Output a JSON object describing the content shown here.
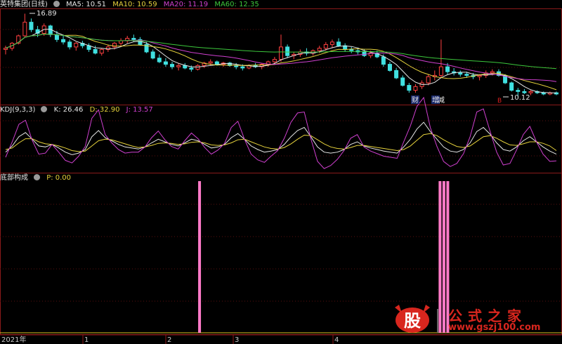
{
  "header": {
    "title": "英特集团(日线)",
    "ma": [
      {
        "label": "MA5: 10.51",
        "color": "#e6e6e6"
      },
      {
        "label": "MA10: 10.59",
        "color": "#e6d23c"
      },
      {
        "label": "MA20: 11.19",
        "color": "#d040d0"
      },
      {
        "label": "MA60: 12.35",
        "color": "#3cc83c"
      }
    ]
  },
  "kdj": {
    "title": "KDJ(9,3,3)",
    "k": "K: 26.46",
    "d": "D: 32.90",
    "j": "J: 13.57",
    "colors": {
      "k": "#e6e6e6",
      "d": "#e6d23c",
      "j": "#d040d0"
    }
  },
  "bottom": {
    "title": "底部构成",
    "p": "P: 0.00",
    "color": "#ff7ac8"
  },
  "annotations": {
    "high": "16.89",
    "low": "10.12",
    "badge_cai": "财",
    "badge_zeng": "增",
    "badge_jian": "减",
    "mark_red": "B"
  },
  "xaxis": {
    "labels": [
      "2021年",
      "1",
      "2",
      "3",
      "4"
    ]
  },
  "watermark": {
    "logo_text": "股",
    "title": "公式之家",
    "url": "www.gszj100.com"
  },
  "chart_data": [
    {
      "type": "candlestick",
      "title": "英特集团(日线)",
      "ylim": [
        9.6,
        17.2
      ],
      "high_label": 16.89,
      "low_label": 10.12,
      "ohlc": [
        [
          14.0,
          14.3,
          13.6,
          14.1
        ],
        [
          14.1,
          14.6,
          13.9,
          14.5
        ],
        [
          14.5,
          15.2,
          14.4,
          15.1
        ],
        [
          15.1,
          16.89,
          15.0,
          16.2
        ],
        [
          16.2,
          16.5,
          15.4,
          15.6
        ],
        [
          15.6,
          15.9,
          15.0,
          15.3
        ],
        [
          15.3,
          16.1,
          15.1,
          15.9
        ],
        [
          15.9,
          16.0,
          15.0,
          15.2
        ],
        [
          15.2,
          15.5,
          14.6,
          14.8
        ],
        [
          14.8,
          15.1,
          14.4,
          14.6
        ],
        [
          14.6,
          14.8,
          14.0,
          14.2
        ],
        [
          14.2,
          14.6,
          13.9,
          14.5
        ],
        [
          14.5,
          14.7,
          14.1,
          14.3
        ],
        [
          14.3,
          14.5,
          13.8,
          14.0
        ],
        [
          14.0,
          14.3,
          13.6,
          13.7
        ],
        [
          13.7,
          14.1,
          13.5,
          14.0
        ],
        [
          14.0,
          14.4,
          13.8,
          14.2
        ],
        [
          14.2,
          14.6,
          14.0,
          14.5
        ],
        [
          14.5,
          14.9,
          14.3,
          14.7
        ],
        [
          14.7,
          15.1,
          14.5,
          14.9
        ],
        [
          14.9,
          15.2,
          14.6,
          14.8
        ],
        [
          14.8,
          15.0,
          14.3,
          14.4
        ],
        [
          14.4,
          14.6,
          13.7,
          13.8
        ],
        [
          13.8,
          14.0,
          13.2,
          13.3
        ],
        [
          13.3,
          13.6,
          12.9,
          13.0
        ],
        [
          13.0,
          13.3,
          12.6,
          12.8
        ],
        [
          12.8,
          13.0,
          12.4,
          12.6
        ],
        [
          12.6,
          12.9,
          12.3,
          12.7
        ],
        [
          12.7,
          12.9,
          12.4,
          12.5
        ],
        [
          12.5,
          12.7,
          12.2,
          12.4
        ],
        [
          12.4,
          12.8,
          12.3,
          12.7
        ],
        [
          12.7,
          13.0,
          12.5,
          12.9
        ],
        [
          12.9,
          13.2,
          12.7,
          13.0
        ],
        [
          13.0,
          13.1,
          12.7,
          12.8
        ],
        [
          12.8,
          13.0,
          12.6,
          12.9
        ],
        [
          12.9,
          13.0,
          12.6,
          12.7
        ],
        [
          12.7,
          12.9,
          12.4,
          12.6
        ],
        [
          12.6,
          12.8,
          12.3,
          12.5
        ],
        [
          12.5,
          12.8,
          12.4,
          12.7
        ],
        [
          12.7,
          12.9,
          12.5,
          12.6
        ],
        [
          12.6,
          12.9,
          12.4,
          12.8
        ],
        [
          12.8,
          13.1,
          12.6,
          13.0
        ],
        [
          13.0,
          13.4,
          12.8,
          13.2
        ],
        [
          13.2,
          15.2,
          13.0,
          14.2
        ],
        [
          14.2,
          14.4,
          13.3,
          13.5
        ],
        [
          13.5,
          13.8,
          13.2,
          13.6
        ],
        [
          13.6,
          14.0,
          13.4,
          13.8
        ],
        [
          13.8,
          14.1,
          13.5,
          13.7
        ],
        [
          13.7,
          14.0,
          13.5,
          13.9
        ],
        [
          13.9,
          14.3,
          13.7,
          14.1
        ],
        [
          14.1,
          14.6,
          13.9,
          14.4
        ],
        [
          14.4,
          14.8,
          14.1,
          14.6
        ],
        [
          14.6,
          14.9,
          14.2,
          14.3
        ],
        [
          14.3,
          14.5,
          13.8,
          14.0
        ],
        [
          14.0,
          14.2,
          13.7,
          13.9
        ],
        [
          13.9,
          14.1,
          13.6,
          13.8
        ],
        [
          13.8,
          14.0,
          13.4,
          13.5
        ],
        [
          13.5,
          13.9,
          13.3,
          13.7
        ],
        [
          13.7,
          13.9,
          13.3,
          13.4
        ],
        [
          13.4,
          13.6,
          12.6,
          12.8
        ],
        [
          12.8,
          13.0,
          12.2,
          12.3
        ],
        [
          12.3,
          12.5,
          11.6,
          11.7
        ],
        [
          11.7,
          11.9,
          11.0,
          11.1
        ],
        [
          11.1,
          11.3,
          10.5,
          10.7
        ],
        [
          10.7,
          11.2,
          10.5,
          11.0
        ],
        [
          11.0,
          11.5,
          10.8,
          11.3
        ],
        [
          11.3,
          12.0,
          11.1,
          11.8
        ],
        [
          11.8,
          12.3,
          11.5,
          11.9
        ],
        [
          11.9,
          14.8,
          11.7,
          12.6
        ],
        [
          12.6,
          12.9,
          12.0,
          12.2
        ],
        [
          12.2,
          12.5,
          11.9,
          12.1
        ],
        [
          12.1,
          12.3,
          11.8,
          12.0
        ],
        [
          12.0,
          12.2,
          11.7,
          11.9
        ],
        [
          11.9,
          12.1,
          11.6,
          11.8
        ],
        [
          11.8,
          12.0,
          11.5,
          11.9
        ],
        [
          11.9,
          12.3,
          11.7,
          12.1
        ],
        [
          12.1,
          12.4,
          11.9,
          12.2
        ],
        [
          12.2,
          12.4,
          11.8,
          11.9
        ],
        [
          11.9,
          12.0,
          11.2,
          11.3
        ],
        [
          11.3,
          11.4,
          10.6,
          10.7
        ],
        [
          10.7,
          10.9,
          10.12,
          10.6
        ],
        [
          10.6,
          10.8,
          10.4,
          10.5
        ],
        [
          10.5,
          10.7,
          10.3,
          10.6
        ],
        [
          10.6,
          10.7,
          10.4,
          10.5
        ],
        [
          10.5,
          10.6,
          10.3,
          10.4
        ],
        [
          10.4,
          10.6,
          10.3,
          10.5
        ],
        [
          10.5,
          10.6,
          10.3,
          10.4
        ]
      ]
    },
    {
      "type": "line",
      "title": "KDJ(9,3,3)",
      "ylim": [
        -10,
        110
      ],
      "series": [
        {
          "name": "K",
          "values": [
            30,
            42,
            60,
            68,
            55,
            42,
            40,
            45,
            38,
            30,
            25,
            28,
            35,
            60,
            72,
            58,
            52,
            45,
            40,
            38,
            36,
            40,
            48,
            55,
            50,
            45,
            42,
            48,
            55,
            52,
            45,
            38,
            40,
            45,
            58,
            66,
            55,
            42,
            35,
            30,
            32,
            35,
            45,
            60,
            72,
            78,
            60,
            40,
            30,
            28,
            30,
            35,
            45,
            50,
            42,
            38,
            35,
            32,
            30,
            28,
            40,
            55,
            75,
            88,
            70,
            55,
            40,
            32,
            30,
            35,
            48,
            70,
            78,
            65,
            48,
            35,
            32,
            40,
            52,
            60,
            50,
            40,
            32,
            26
          ]
        },
        {
          "name": "D",
          "values": [
            35,
            38,
            48,
            56,
            56,
            50,
            46,
            45,
            42,
            38,
            33,
            31,
            32,
            42,
            52,
            55,
            54,
            50,
            46,
            42,
            39,
            40,
            43,
            47,
            48,
            47,
            45,
            46,
            49,
            50,
            48,
            44,
            43,
            44,
            48,
            54,
            55,
            50,
            45,
            40,
            37,
            36,
            39,
            46,
            55,
            63,
            62,
            54,
            46,
            40,
            37,
            36,
            39,
            43,
            43,
            41,
            39,
            37,
            35,
            33,
            35,
            42,
            53,
            64,
            66,
            62,
            54,
            47,
            41,
            39,
            42,
            51,
            60,
            62,
            57,
            50,
            44,
            43,
            46,
            50,
            50,
            47,
            42,
            33
          ]
        },
        {
          "name": "J",
          "values": [
            20,
            50,
            84,
            92,
            53,
            26,
            28,
            45,
            30,
            14,
            9,
            22,
            41,
            96,
            112,
            64,
            48,
            35,
            28,
            30,
            30,
            40,
            58,
            71,
            54,
            41,
            36,
            52,
            67,
            56,
            39,
            26,
            34,
            47,
            78,
            90,
            55,
            26,
            15,
            10,
            22,
            33,
            57,
            88,
            106,
            108,
            56,
            12,
            -2,
            4,
            16,
            33,
            57,
            64,
            40,
            32,
            27,
            22,
            20,
            18,
            50,
            81,
            119,
            136,
            78,
            41,
            12,
            2,
            8,
            27,
            60,
            108,
            114,
            71,
            30,
            5,
            8,
            34,
            64,
            80,
            50,
            26,
            12,
            13
          ]
        }
      ]
    },
    {
      "type": "bar",
      "title": "底部构成",
      "ylim": [
        0,
        1
      ],
      "x": [
        "2021-01-26",
        "2021-03-29",
        "2021-03-30",
        "2021-03-31"
      ],
      "values": [
        1,
        1,
        1,
        1
      ],
      "current_value": 0.0
    }
  ]
}
